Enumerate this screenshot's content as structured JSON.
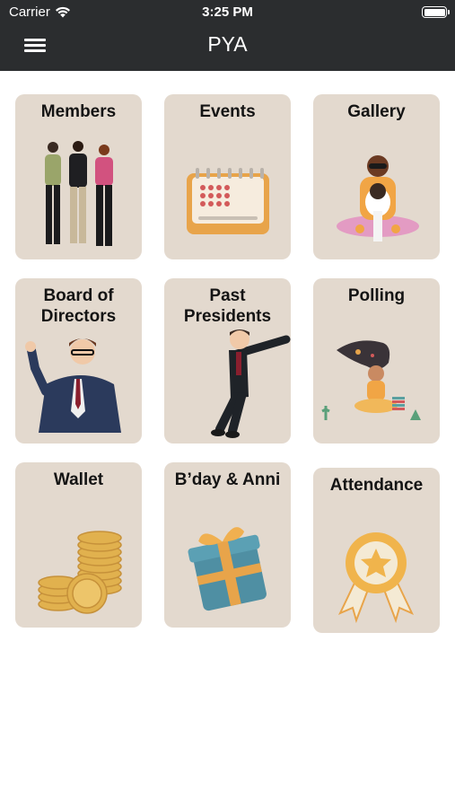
{
  "status_bar": {
    "carrier": "Carrier",
    "time": "3:25 PM"
  },
  "header": {
    "title": "PYA",
    "menu_icon": "hamburger-menu-icon"
  },
  "tiles": [
    {
      "label": "Members",
      "icon": "people-group-icon"
    },
    {
      "label": "Events",
      "icon": "calendar-icon"
    },
    {
      "label": "Gallery",
      "icon": "photographer-with-dog-icon"
    },
    {
      "label": "Board of Directors",
      "line1": "Board of",
      "line2": "Directors",
      "icon": "waving-businessman-icon"
    },
    {
      "label": "Past Presidents",
      "line1": "Past",
      "line2": "Presidents",
      "icon": "leaning-businessman-icon"
    },
    {
      "label": "Polling",
      "icon": "thinking-woman-icon"
    },
    {
      "label": "Wallet",
      "icon": "coin-stacks-icon"
    },
    {
      "label": "B’day & Anni",
      "icon": "gift-box-icon"
    },
    {
      "label": "Attendance",
      "icon": "award-badge-icon"
    }
  ],
  "colors": {
    "header_bg": "#2b2d2f",
    "tile_bg": "#e3d9ce",
    "page_bg": "#ffffff"
  }
}
